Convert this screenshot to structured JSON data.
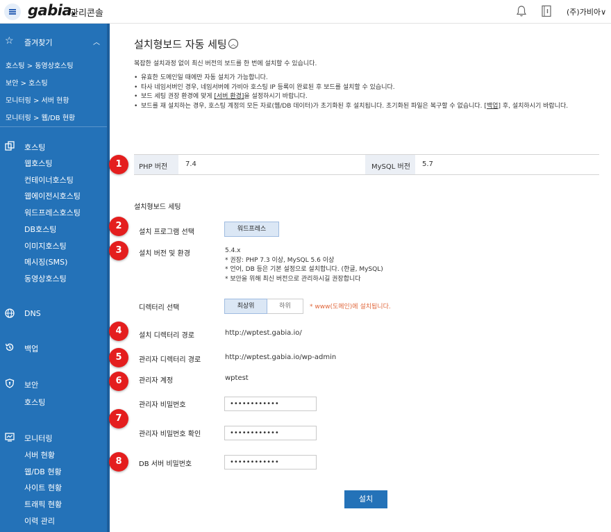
{
  "topbar": {
    "logo": "gabia.",
    "console": "관리콘솔",
    "account": "(주)가비아∨"
  },
  "sidebar": {
    "favorites": "즐겨찾기",
    "quick": [
      "호스팅 > 동영상호스팅",
      "보안 > 호스팅",
      "모니터링 > 서버 현황",
      "모니터링 > 웹/DB 현황"
    ],
    "hosting": {
      "label": "호스팅",
      "items": [
        "웹호스팅",
        "컨테이너호스팅",
        "웹에이전시호스팅",
        "워드프레스호스팅",
        "DB호스팅",
        "이미지호스팅",
        "메시징(SMS)",
        "동영상호스팅"
      ]
    },
    "dns": "DNS",
    "backup": "백업",
    "security": {
      "label": "보안",
      "items": [
        "호스팅"
      ]
    },
    "monitoring": {
      "label": "모니터링",
      "items": [
        "서버 현황",
        "웹/DB 현황",
        "사이트 현황",
        "트래픽 현황",
        "이력 관리"
      ]
    }
  },
  "page": {
    "title": "설치형보드 자동 세팅",
    "desc": "복잡한 설치과정 없이 최신 버전의 보드를 한 번에 설치할 수 있습니다.",
    "notes": [
      "유효한 도메인일 때에만 자동 설치가 가능합니다.",
      "타사 네임서버인 경우, 네임서버에 가비아 호스팅 IP 등록이 완료된 후 보드를 설치할 수 있습니다."
    ],
    "note3_a": "보드 세팅 권장 환경에 맞게 ",
    "note3_link": "[서버 환경]",
    "note3_b": "을 설정하시기 바랍니다.",
    "note4_a": "보드를 재 설치하는 경우, 호스팅 계정의 모든 자료(웹/DB 데이터)가 초기화된 후 설치됩니다. 초기화된 파일은 복구할 수 없습니다. ",
    "note4_link": "[백업]",
    "note4_b": " 후, 설치하시기 바랍니다.",
    "php_label": "PHP 버전",
    "php_value": "7.4",
    "mysql_label": "MySQL 버전",
    "mysql_value": "5.7",
    "section": "설치형보드 세팅",
    "program_label": "설치 프로그램 선택",
    "program_button": "워드프레스",
    "version_label": "설치 버전 및 환경",
    "version_lines": [
      "5.4.x",
      "* 권장: PHP 7.3 이상, MySQL 5.6 이상",
      "* 언어, DB 등은 기본 설정으로 설치합니다. (한글, MySQL)",
      "* 보안을 위해 최신 버전으로 관리하시길 권장합니다"
    ],
    "dir_label": "디렉터리 선택",
    "dir_top": "최상위",
    "dir_sub": "하위",
    "dir_note": "* www(도메인)에 설치됩니다.",
    "install_dir_label": "설치 디렉터리 경로",
    "install_dir_value": "http://wptest.gabia.io/",
    "admin_dir_label": "관리자 디렉터리 경로",
    "admin_dir_value": "http://wptest.gabia.io/wp-admin",
    "admin_account_label": "관리자 계정",
    "admin_account_value": "wptest",
    "admin_pw_label": "관리자 비밀번호",
    "admin_pw_value": "••••••••••••",
    "admin_pw_confirm_label": "관리자 비밀번호 확인",
    "admin_pw_confirm_value": "••••••••••••",
    "db_pw_label": "DB 서버 비밀번호",
    "db_pw_value": "••••••••••••",
    "install_button": "설치"
  },
  "badges": [
    "1",
    "2",
    "3",
    "4",
    "5",
    "6",
    "7",
    "8"
  ],
  "colors": {
    "sidebar": "#2472b8",
    "badge": "#e41e1e",
    "accent": "#2472b8",
    "warning": "#e0663a"
  },
  "icons": [
    "menu-icon",
    "bell-icon",
    "book-icon",
    "star-icon",
    "chevron-up-icon",
    "hosting-icon",
    "globe-icon",
    "backup-icon",
    "shield-icon",
    "monitor-icon",
    "chevron-up-circle-icon"
  ]
}
